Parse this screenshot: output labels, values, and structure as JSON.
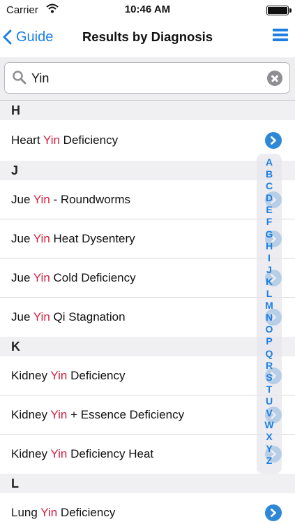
{
  "status_bar": {
    "carrier": "Carrier",
    "time": "10:46 AM"
  },
  "nav": {
    "back_label": "Guide",
    "title": "Results by Diagnosis"
  },
  "search": {
    "value": "Yin"
  },
  "sections": [
    {
      "letter": "H",
      "rows": [
        {
          "pre": "Heart ",
          "hl": "Yin",
          "post": " Deficiency"
        }
      ]
    },
    {
      "letter": "J",
      "rows": [
        {
          "pre": "Jue ",
          "hl": "Yin",
          "post": " - Roundworms"
        },
        {
          "pre": "Jue ",
          "hl": "Yin",
          "post": " Heat Dysentery"
        },
        {
          "pre": "Jue ",
          "hl": "Yin",
          "post": " Cold Deficiency"
        },
        {
          "pre": "Jue ",
          "hl": "Yin",
          "post": " Qi Stagnation"
        }
      ]
    },
    {
      "letter": "K",
      "rows": [
        {
          "pre": "Kidney ",
          "hl": "Yin",
          "post": " Deficiency"
        },
        {
          "pre": "Kidney ",
          "hl": "Yin",
          "post": " + Essence Deficiency"
        },
        {
          "pre": "Kidney ",
          "hl": "Yin",
          "post": " Deficiency Heat"
        }
      ]
    },
    {
      "letter": "L",
      "rows": [
        {
          "pre": "Lung ",
          "hl": "Yin",
          "post": " Deficiency"
        }
      ]
    }
  ],
  "index_letters": [
    "A",
    "B",
    "C",
    "D",
    "E",
    "F",
    "G",
    "H",
    "I",
    "J",
    "K",
    "L",
    "M",
    "N",
    "O",
    "P",
    "Q",
    "R",
    "S",
    "T",
    "U",
    "V",
    "W",
    "X",
    "Y",
    "Z"
  ],
  "colors": {
    "accent": "#1b7fe3",
    "highlight": "#d0203f",
    "disclosure": "#2f88d6"
  },
  "icons": {
    "back": "chevron-left-icon",
    "menu": "hamburger-menu-icon",
    "search": "magnifier-icon",
    "clear": "clear-circle-icon",
    "row": "chevron-right-circle-icon"
  }
}
